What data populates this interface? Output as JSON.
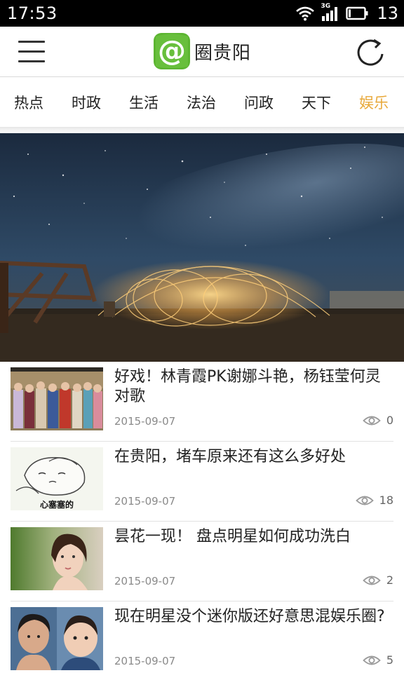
{
  "status_bar": {
    "time": "17:53",
    "network": "3G",
    "battery": "13",
    "icons": [
      "wifi-icon",
      "signal-icon",
      "battery-icon"
    ]
  },
  "header": {
    "brand_name": "圈贵阳",
    "logo_glyph": "@",
    "icons": [
      "menu-icon",
      "app-logo-icon",
      "refresh-icon"
    ],
    "colors": {
      "logo_green": "#5cb531"
    }
  },
  "tabs": [
    {
      "label": "热点",
      "active": false
    },
    {
      "label": "时政",
      "active": false
    },
    {
      "label": "生活",
      "active": false
    },
    {
      "label": "法治",
      "active": false
    },
    {
      "label": "问政",
      "active": false
    },
    {
      "label": "天下",
      "active": false
    },
    {
      "label": "娱乐",
      "active": true
    }
  ],
  "banner": {
    "overlay_glyph": "@",
    "slide_count": 5,
    "active_slide": 4,
    "colors": {
      "dot_active": "#e0272b",
      "dot_inactive": "#b8b8b8"
    }
  },
  "news": [
    {
      "title": "好戏！林青霞PK谢娜斗艳，杨钰莹何灵对歌",
      "date": "2015-09-07",
      "views": "0"
    },
    {
      "title": "在贵阳，堵车原来还有这么多好处",
      "date": "2015-09-07",
      "views": "18",
      "thumb_caption": "心塞塞的"
    },
    {
      "title": "昙花一现！ 盘点明星如何成功洗白",
      "date": "2015-09-07",
      "views": "2"
    },
    {
      "title": "现在明星没个迷你版还好意思混娱乐圈?",
      "date": "2015-09-07",
      "views": "5"
    }
  ],
  "theme": {
    "active_tab_color": "#e8a93b"
  }
}
